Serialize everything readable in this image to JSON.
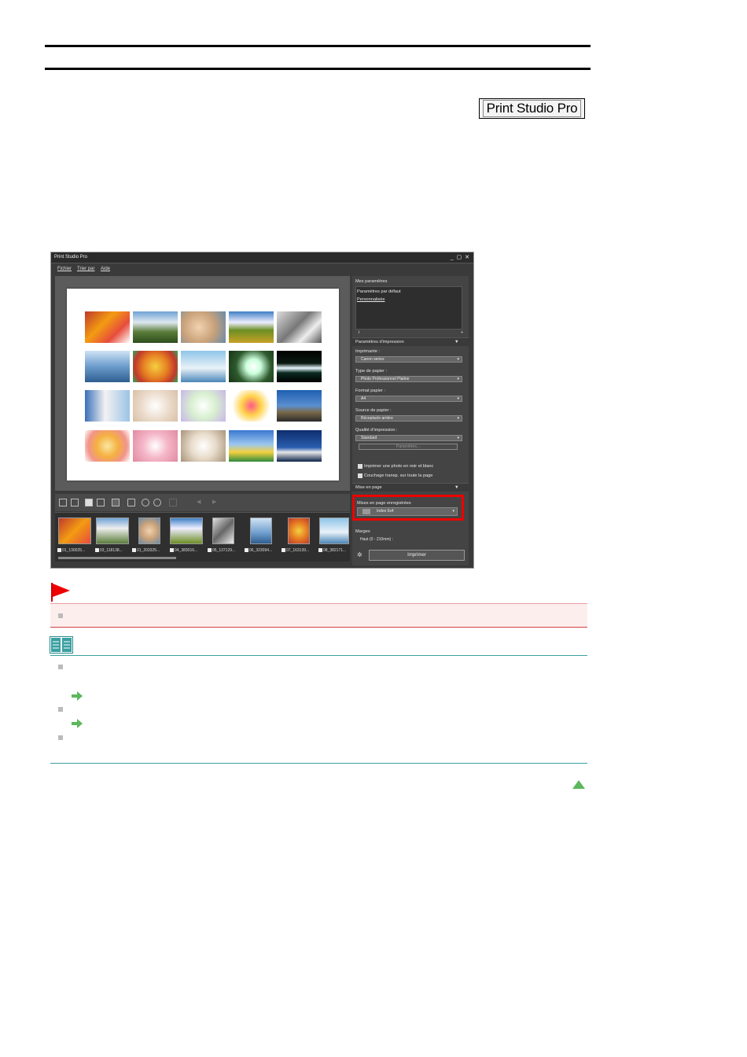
{
  "badge": {
    "label": "Print Studio Pro"
  },
  "app": {
    "title": "Print Studio Pro",
    "window_controls": "_ ▢ ✕",
    "menu": [
      "Fichier",
      "Trier par",
      "Aide"
    ],
    "filmstrip": [
      "01_130025...",
      "03_118138...",
      "01_203325...",
      "04_383016...",
      "05_137129...",
      "06_323094...",
      "07_163139...",
      "08_382171..."
    ],
    "panel": {
      "my_settings": "Mes paramètres",
      "default_settings": "Paramètres par défaut",
      "custom": "Personnalisée",
      "info": "i",
      "plus": "+",
      "print_settings": "Paramètres d'impression",
      "printer_label": "Imprimante :",
      "printer_value": "Canon          series",
      "paper_type_label": "Type de papier :",
      "paper_type_value": "Photo Professionnel Platine",
      "paper_size_label": "Format papier :",
      "paper_size_value": "A4",
      "paper_source_label": "Source de papier :",
      "paper_source_value": "Réceptacle arrière",
      "quality_label": "Qualité d'impression :",
      "quality_value": "Standard",
      "settings_button": "Paramètres...",
      "bw_option": "Imprimer une photo en noir et blanc",
      "coating_option": "Couchage transp. sur toute la page",
      "layout_section": "Mise en page",
      "saved_layouts_label": "Mises en page enregistrées",
      "saved_layout_value": "Index 5x4",
      "margins_label": "Marges",
      "margin_top_label": "Haut (0 - 210mm) :",
      "print_button": "Imprimer"
    }
  },
  "colors": {
    "highlight": "#e00000",
    "note_accent": "#3aa0a0",
    "caution_bg": "#fdeeee",
    "arrow_green": "#5cb85c"
  }
}
